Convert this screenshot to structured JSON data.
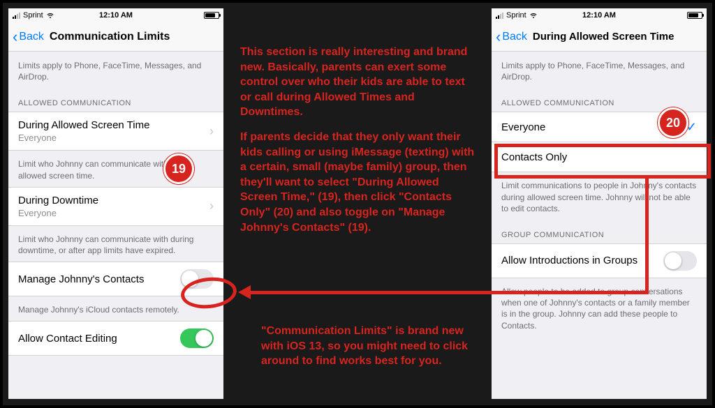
{
  "status": {
    "carrier": "Sprint",
    "time": "12:10 AM"
  },
  "leftPhone": {
    "back": "Back",
    "title": "Communication Limits",
    "topNote": "Limits apply to Phone, FaceTime, Messages, and AirDrop.",
    "sectionHeader": "ALLOWED COMMUNICATION",
    "row1": {
      "title": "During Allowed Screen Time",
      "sub": "Everyone"
    },
    "row1Note": "Limit who Johnny can communicate with during allowed screen time.",
    "row2": {
      "title": "During Downtime",
      "sub": "Everyone"
    },
    "row2Note": "Limit who Johnny can communicate with during downtime, or after app limits have expired.",
    "row3": {
      "title": "Manage Johnny's Contacts"
    },
    "row3Note": "Manage Johnny's iCloud contacts remotely.",
    "row4": {
      "title": "Allow Contact Editing"
    }
  },
  "rightPhone": {
    "back": "Back",
    "title": "During Allowed Screen Time",
    "topNote": "Limits apply to Phone, FaceTime, Messages, and AirDrop.",
    "sectionHeader": "ALLOWED COMMUNICATION",
    "opt1": "Everyone",
    "opt2": "Contacts Only",
    "optNote": "Limit communications to people in Johnny's contacts during allowed screen time. Johnny will not be able to edit contacts.",
    "sectionHeader2": "GROUP COMMUNICATION",
    "groupRow": "Allow Introductions in Groups",
    "groupNote": "Allow people to be added to group conversations when one of Johnny's contacts or a family member is in the group. Johnny can add these people to Contacts."
  },
  "annotations": {
    "para1": "This section is really interesting and brand new. Basically, parents can exert some control over who their kids are able to text or call during Allowed Times and Downtimes.",
    "para2": "If parents decide that they only want their kids calling or using iMessage (texting) with a certain, small (maybe family) group, then they'll want to select \"During Allowed Screen Time,\" (19), then click \"Contacts Only\" (20) and also toggle on \"Manage Johnny's Contacts\" (19).",
    "para3": "\"Communication Limits\" is brand new with iOS 13, so you might need to click around to find works best for you.",
    "badge19": "19",
    "badge20": "20"
  }
}
